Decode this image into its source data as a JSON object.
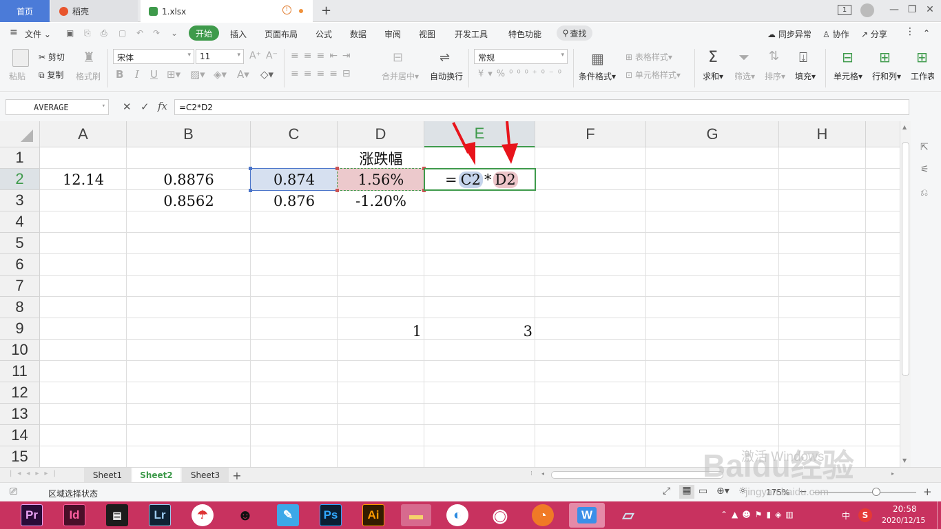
{
  "tabs": {
    "home": "首页",
    "daoke": "稻壳",
    "file": "1.xlsx",
    "new_tab": "+",
    "badge": "1"
  },
  "menu": {
    "file": "文件",
    "start": "开始",
    "insert": "插入",
    "page_layout": "页面布局",
    "formula": "公式",
    "data": "数据",
    "review": "审阅",
    "view": "视图",
    "developer": "开发工具",
    "special": "特色功能",
    "find": "查找",
    "sync": "同步异常",
    "collab": "协作",
    "share": "分享"
  },
  "ribbon": {
    "paste": "粘贴",
    "cut": "剪切",
    "copy": "复制",
    "format_painter": "格式刷",
    "font_name": "宋体",
    "font_size": "11",
    "merge_center": "合并居中",
    "wrap_text": "自动换行",
    "number_format": "常规",
    "conditional_format": "条件格式",
    "table_style": "表格样式",
    "cell_style": "单元格样式",
    "sum": "求和",
    "filter": "筛选",
    "sort": "排序",
    "fill": "填充",
    "cell": "单元格",
    "row_col": "行和列",
    "worksheet": "工作表"
  },
  "formula_bar": {
    "name_box": "AVERAGE",
    "fx": "fx",
    "formula": "=C2*D2"
  },
  "grid": {
    "columns": [
      "A",
      "B",
      "C",
      "D",
      "E",
      "F",
      "G",
      "H"
    ],
    "active_column": "E",
    "rows": [
      "1",
      "2",
      "3",
      "4",
      "5",
      "6",
      "7",
      "8",
      "9",
      "10",
      "11",
      "12",
      "13",
      "14",
      "15"
    ],
    "active_row": "2",
    "cells": {
      "D1": "涨跌幅",
      "A2": "12.14",
      "B2": "0.8876",
      "C2": "0.874",
      "D2": "1.56%",
      "E2_eq": "=",
      "E2_ref1": "C2",
      "E2_op": "*",
      "E2_ref2": "D2",
      "B3": "0.8562",
      "C3": "0.876",
      "D3": "-1.20%",
      "D9": "1",
      "E9": "3"
    }
  },
  "sheets": {
    "tabs": [
      "Sheet1",
      "Sheet2",
      "Sheet3"
    ],
    "active": "Sheet2",
    "add": "+"
  },
  "status": {
    "mode": "区域选择状态",
    "zoom": "175%"
  },
  "taskbar": {
    "apps": [
      "Pr",
      "Id",
      "Lr",
      "Ps",
      "Ai"
    ],
    "time": "20:58",
    "date": "2020/12/15",
    "ime": "中"
  },
  "watermark": {
    "activate": "激活 Windows",
    "brand": "Baidu经验",
    "url": "jingyan.baidu.com"
  },
  "colors": {
    "accent_green": "#3e9a4b",
    "ref_blue": "#c5d4ec",
    "ref_red": "#ecc5c9",
    "taskbar": "#c8325f",
    "arrow": "#e8141b"
  }
}
